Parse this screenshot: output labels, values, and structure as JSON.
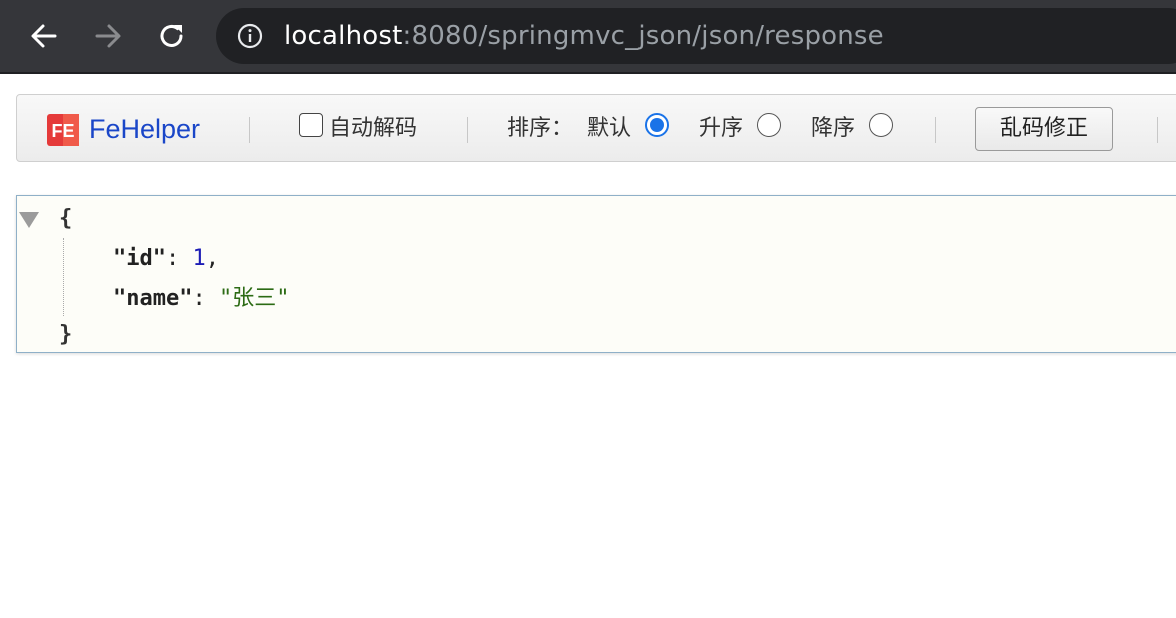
{
  "browser": {
    "url_host": "localhost",
    "url_rest": ":8080/springmvc_json/json/response",
    "icons": [
      "back-arrow-icon",
      "forward-arrow-icon",
      "reload-icon",
      "info-icon"
    ]
  },
  "fehelper": {
    "brand": "FeHelper",
    "logo_text": "FE",
    "auto_decode_label": "自动解码",
    "auto_decode_checked": false,
    "sort_label": "排序：",
    "sort_options": [
      {
        "label": "默认",
        "selected": true
      },
      {
        "label": "升序",
        "selected": false
      },
      {
        "label": "降序",
        "selected": false
      }
    ],
    "fix_button_label": "乱码修正"
  },
  "json": {
    "open_brace": "{",
    "close_brace": "}",
    "fields": [
      {
        "key": "\"id\"",
        "value": "1",
        "type": "number",
        "trailing": ","
      },
      {
        "key": "\"name\"",
        "value": "\"张三\"",
        "type": "string",
        "trailing": ""
      }
    ]
  },
  "colors": {
    "chrome_bg": "#35363a",
    "omnibox_bg": "#202124",
    "brand_blue": "#1a46c8",
    "radio_selected": "#1a73e8",
    "json_number": "#1c1cb5",
    "json_string": "#2c6b14"
  }
}
